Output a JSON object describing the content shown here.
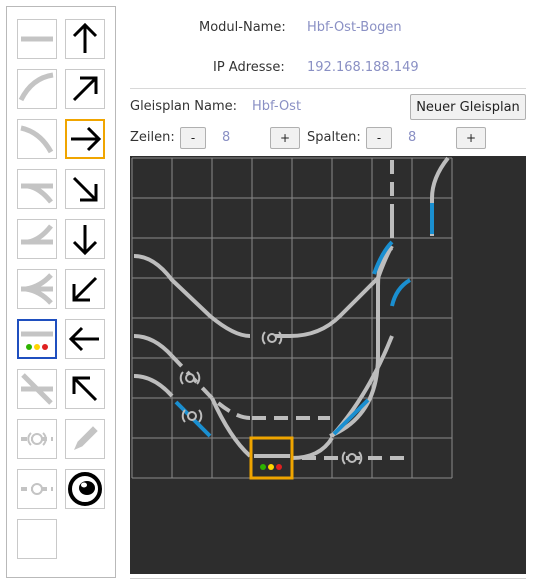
{
  "module": {
    "name_label": "Modul-Name:",
    "name_value": "Hbf-Ost-Bogen",
    "ip_label": "IP Adresse:",
    "ip_value": "192.168.188.149"
  },
  "plan": {
    "name_label": "Gleisplan Name:",
    "name_value": "Hbf-Ost",
    "new_button": "Neuer Gleisplan",
    "rows_label": "Zeilen:",
    "rows_value": "8",
    "cols_label": "Spalten:",
    "cols_value": "8",
    "minus": "-",
    "plus": "+"
  },
  "palette": {
    "tools": [
      "straight-track",
      "curve-track-up",
      "curve-track-down",
      "switch-left",
      "switch-right",
      "switch-double",
      "signal-track",
      "crossing-track",
      "sensor-track",
      "uncoupler-track",
      "empty-tile"
    ],
    "directions": [
      "arrow-up",
      "arrow-up-right",
      "arrow-right",
      "arrow-down-right",
      "arrow-down",
      "arrow-down-left",
      "arrow-left",
      "arrow-up-left",
      "pencil",
      "eye"
    ],
    "selected_tool": "signal-track",
    "selected_direction": "arrow-right"
  },
  "colors": {
    "track": "#bdbdbd",
    "switch_active": "#1a8fd0",
    "grid_line": "#8a8a8a",
    "grid_bg": "#2d2d2d",
    "selection": "#f0a500",
    "signal_green": "#2db300",
    "signal_yellow": "#ffd400",
    "signal_red": "#e02020"
  }
}
